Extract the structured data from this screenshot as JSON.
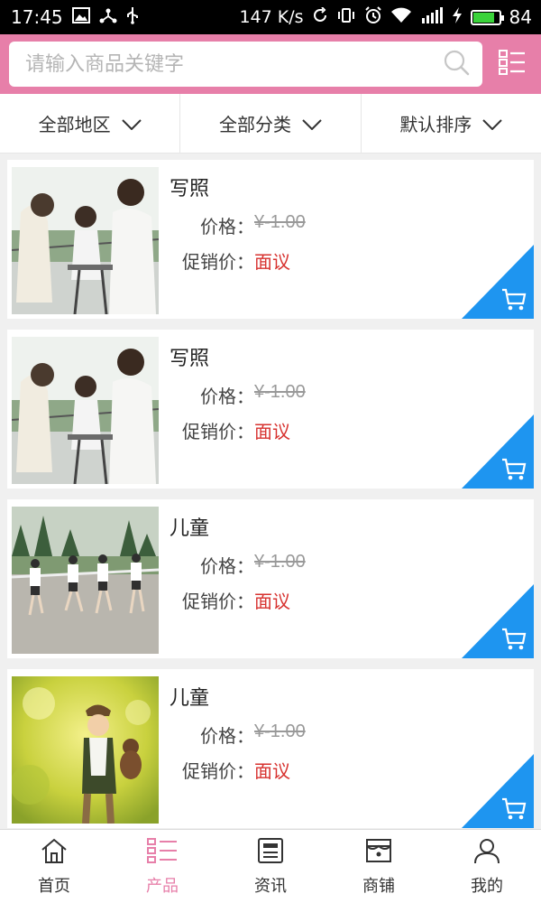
{
  "status_bar": {
    "time": "17:45",
    "net_speed": "147 K/s",
    "battery": "84",
    "battery_fraction": 0.84
  },
  "search": {
    "placeholder": "请输入商品关键字"
  },
  "filters": [
    {
      "label": "全部地区"
    },
    {
      "label": "全部分类"
    },
    {
      "label": "默认排序"
    }
  ],
  "products": [
    {
      "title": "写照",
      "price_label": "价格：",
      "price": "¥-1.00",
      "sale_label": "促销价：",
      "sale": "面议",
      "image": "women-cafe-photo"
    },
    {
      "title": "写照",
      "price_label": "价格：",
      "price": "¥-1.00",
      "sale_label": "促销价：",
      "sale": "面议",
      "image": "women-cafe-photo"
    },
    {
      "title": "儿童",
      "price_label": "价格：",
      "price": "¥-1.00",
      "sale_label": "促销价：",
      "sale": "面议",
      "image": "kids-running-photo"
    },
    {
      "title": "儿童",
      "price_label": "价格：",
      "price": "¥-1.00",
      "sale_label": "促销价：",
      "sale": "面议",
      "image": "child-teddy-bear-photo"
    }
  ],
  "tabs": [
    {
      "label": "首页",
      "icon": "home-icon"
    },
    {
      "label": "产品",
      "icon": "product-list-icon",
      "active": true
    },
    {
      "label": "资讯",
      "icon": "news-icon"
    },
    {
      "label": "商铺",
      "icon": "shop-icon"
    },
    {
      "label": "我的",
      "icon": "user-icon"
    }
  ],
  "colors": {
    "accent": "#e77fa9",
    "corner": "#1e95f0",
    "sale": "#d7322f"
  }
}
